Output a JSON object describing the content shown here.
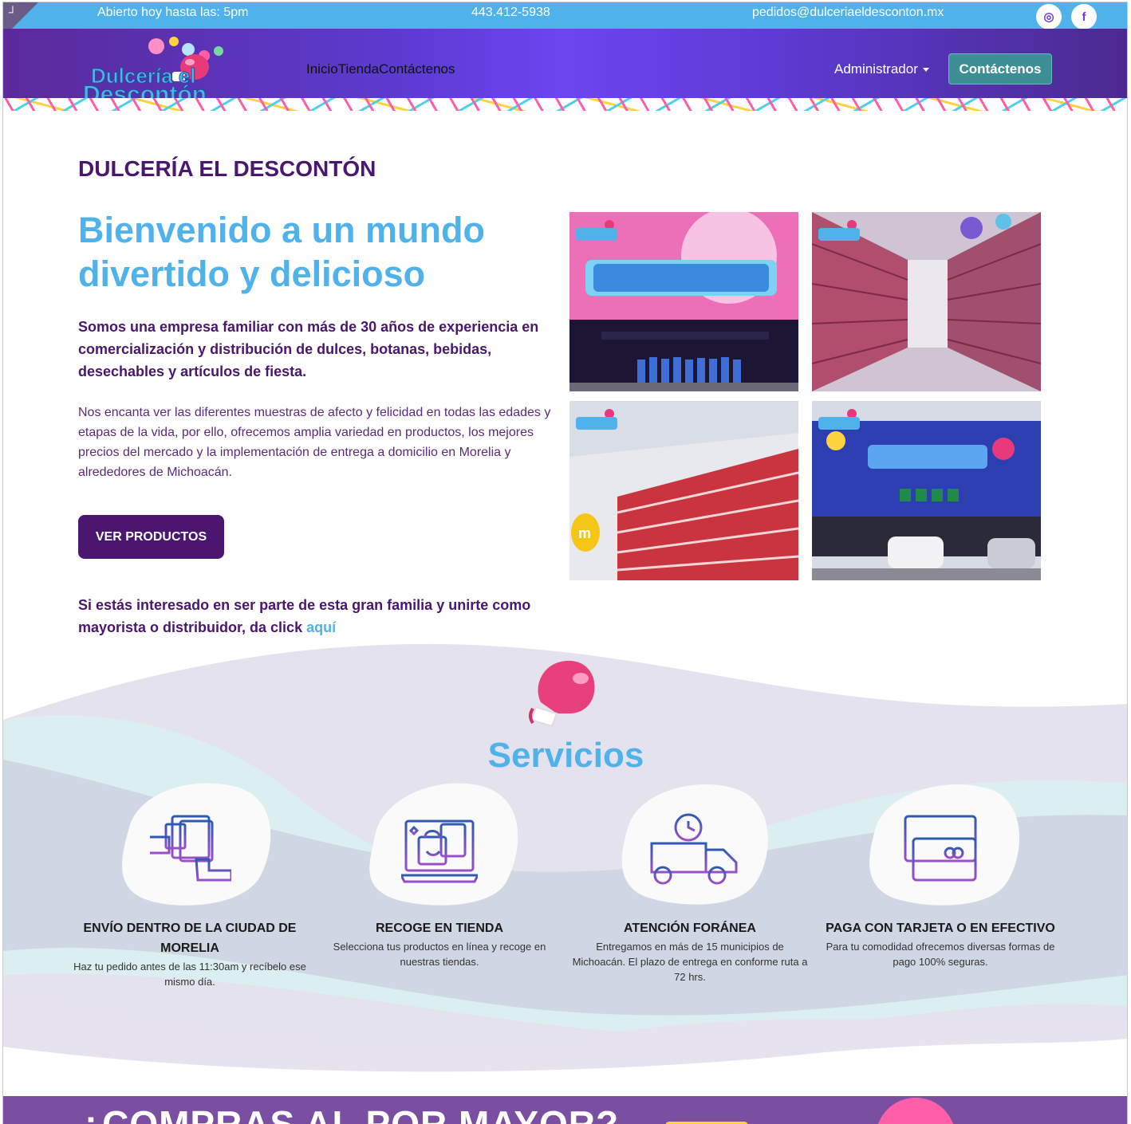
{
  "topbar": {
    "hours": "Abierto hoy hasta las: 5pm",
    "phone": "443.412-5938",
    "email": "pedidos@dulceriaeldesconton.mx",
    "social": [
      {
        "icon": "instagram-icon",
        "glyph": "◎"
      },
      {
        "icon": "facebook-icon",
        "glyph": "f"
      }
    ]
  },
  "navbar": {
    "logo_alt": "Dulcería el Descontón",
    "links": [
      "Inicio",
      "Tienda",
      "Contáctenos"
    ],
    "admin_label": "Administrador",
    "contact_button": "Contáctenos"
  },
  "hero": {
    "brand": "DULCERÍA EL DESCONTÓN",
    "title": "Bienvenido a un mundo divertido y delicioso",
    "lead": "Somos una empresa familiar con más de 30 años de experiencia en comercialización y distribución de dulces, botanas, bebidas, desechables y artículos de fiesta.",
    "body": "Nos encanta ver las diferentes muestras de afecto y felicidad en todas las edades y etapas de la vida, por ello, ofrecemos amplia variedad en productos, los mejores precios del mercado y la implementación de entrega a domicilio en Morelia y alrededores de Michoacán.",
    "cta_label": "VER PRODUCTOS",
    "join_text": "Si estás interesado en ser parte de esta gran familia y unirte como mayorista o distribuidor, da click ",
    "join_link": "aquí"
  },
  "gallery": [
    {
      "name": "storefront-photo",
      "alt": "Fachada con equipo"
    },
    {
      "name": "aisle-photo",
      "alt": "Pasillo de tienda"
    },
    {
      "name": "shelves-photo",
      "alt": "Estantes de botanas"
    },
    {
      "name": "building-photo",
      "alt": "Edificio exterior"
    }
  ],
  "services": {
    "title": "Servicios",
    "items": [
      {
        "icon": "hand-delivery-icon",
        "title": "ENVÍO DENTRO DE LA CIUDAD DE MORELIA",
        "text": "Haz tu pedido antes de las 11:30am y recíbelo ese mismo día."
      },
      {
        "icon": "store-pickup-icon",
        "title": "RECOGE EN TIENDA",
        "text": "Selecciona tus productos en línea y recoge en nuestras tiendas."
      },
      {
        "icon": "truck-icon",
        "title": "ATENCIÓN FORÁNEA",
        "text": "Entregamos en más de 15 municipios de Michoacán. El plazo de entrega en conforme ruta a 72 hrs."
      },
      {
        "icon": "credit-card-icon",
        "title": "PAGA CON TARJETA O EN EFECTIVO",
        "text": "Para tu comodidad ofrecemos diversas formas de pago 100% seguras."
      }
    ]
  },
  "wholesale": {
    "title": "¿COMPRAS AL POR MAYOR?"
  },
  "colors": {
    "accent_blue": "#4fb2ea",
    "brand_purple": "#4a1670",
    "teal_button": "#3e8f95"
  }
}
